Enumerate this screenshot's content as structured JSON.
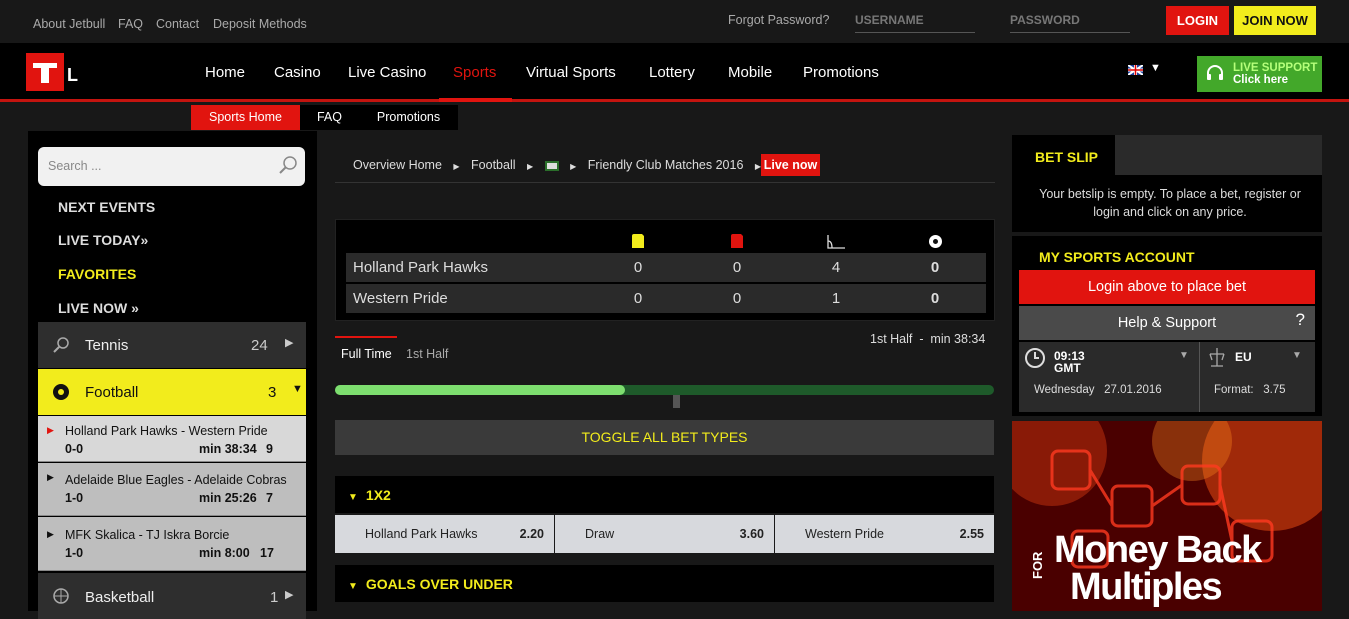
{
  "header": {
    "links": [
      "About Jetbull",
      "FAQ",
      "Contact",
      "Deposit Methods"
    ],
    "forgot_password": "Forgot Password?",
    "username_placeholder": "USERNAME",
    "password_placeholder": "PASSWORD",
    "login_label": "LOGIN",
    "join_label": "JOIN NOW"
  },
  "nav": {
    "items": [
      "Home",
      "Casino",
      "Live Casino",
      "Sports",
      "Virtual Sports",
      "Lottery",
      "Mobile",
      "Promotions"
    ],
    "active": "Sports",
    "live_support": [
      "LIVE SUPPORT",
      "Click here"
    ]
  },
  "subnav": [
    "Sports Home",
    "FAQ",
    "Promotions"
  ],
  "sidebar": {
    "search_placeholder": "Search ...",
    "menu": [
      "NEXT EVENTS",
      "LIVE TODAY»",
      "FAVORITES",
      "LIVE NOW »"
    ],
    "sports": [
      {
        "name": "Tennis",
        "count": "24"
      },
      {
        "name": "Football",
        "count": "3"
      },
      {
        "name": "Basketball",
        "count": "1"
      }
    ],
    "matches": [
      {
        "title": "Holland Park Hawks - Western Pride",
        "score": "0-0",
        "time": "min 38:34",
        "count": "9"
      },
      {
        "title": "Adelaide Blue Eagles - Adelaide Cobras",
        "score": "1-0",
        "time": "min 25:26",
        "count": "7"
      },
      {
        "title": "MFK Skalica - TJ Iskra Borcie",
        "score": "1-0",
        "time": "min 8:00",
        "count": "17"
      }
    ]
  },
  "main": {
    "breadcrumb": [
      "Overview Home",
      "Football",
      "Friendly Club Matches 2016"
    ],
    "live_badge": "Live now",
    "teams": [
      {
        "name": "Holland Park Hawks",
        "yellow": "0",
        "red": "0",
        "corners": "4",
        "goals": "0"
      },
      {
        "name": "Western Pride",
        "yellow": "0",
        "red": "0",
        "corners": "1",
        "goals": "0"
      }
    ],
    "tabs": [
      "Full Time",
      "1st Half"
    ],
    "period_label": "1st Half  -  min 38:34",
    "progress_fraction": 0.44,
    "toggle_label": "TOGGLE ALL BET TYPES",
    "markets": [
      {
        "title": "1X2",
        "odds": [
          {
            "name": "Holland Park Hawks",
            "value": "2.20"
          },
          {
            "name": "Draw",
            "value": "3.60"
          },
          {
            "name": "Western Pride",
            "value": "2.55"
          }
        ]
      },
      {
        "title": "GOALS OVER UNDER"
      }
    ]
  },
  "right": {
    "betslip_title": "BET SLIP",
    "betslip_text": "Your betslip is empty. To place a bet, register or login and click on any price.",
    "account_title": "MY SPORTS ACCOUNT",
    "account_login": "Login above to place bet",
    "account_help": "Help & Support",
    "time": "09:13",
    "tz": "GMT",
    "date": "Wednesday   27.01.2016",
    "odds_region": "EU",
    "format_label": "Format:   3.75",
    "promo_line1": "Money Back",
    "promo_for": "FOR",
    "promo_line2": "Multiples"
  }
}
